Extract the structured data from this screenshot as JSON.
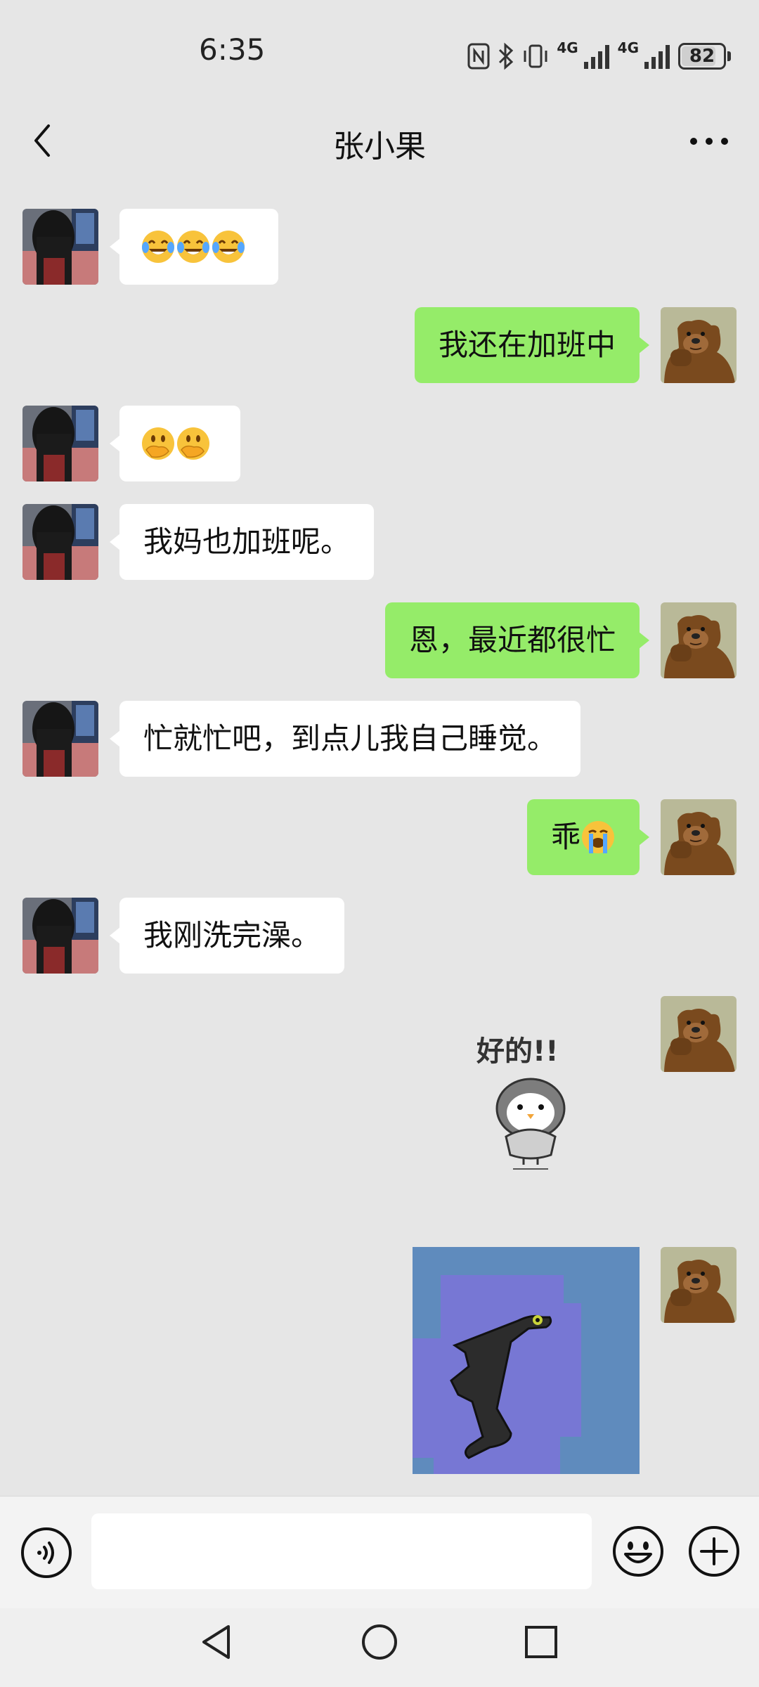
{
  "status_bar": {
    "time": "6:35",
    "network_1": "4G",
    "network_2": "4G",
    "battery": "82"
  },
  "header": {
    "title": "张小果",
    "back_icon": "chevron-left-icon",
    "more_icon": "more-horizontal-icon"
  },
  "messages": [
    {
      "side": "in",
      "type": "emoji",
      "emoji": "face-with-tears-of-joy x3"
    },
    {
      "side": "out",
      "type": "text",
      "text": "我还在加班中"
    },
    {
      "side": "in",
      "type": "emoji",
      "emoji": "face-with-hand-over-mouth x2"
    },
    {
      "side": "in",
      "type": "text",
      "text": "我妈也加班呢。"
    },
    {
      "side": "out",
      "type": "text",
      "text": "恩，最近都很忙"
    },
    {
      "side": "in",
      "type": "text",
      "text": "忙就忙吧，到点儿我自己睡觉。"
    },
    {
      "side": "out",
      "type": "text+emoji",
      "text": "乖",
      "emoji": "loudly-crying-face"
    },
    {
      "side": "in",
      "type": "text",
      "text": "我刚洗完澡。"
    },
    {
      "side": "out",
      "type": "sticker",
      "sticker": "penguin-sticker",
      "caption": "好的!!"
    },
    {
      "side": "out",
      "type": "sticker",
      "sticker": "dragon-dance-sticker"
    }
  ],
  "input_bar": {
    "voice_icon": "voice-icon",
    "emoji_icon": "smile-icon",
    "plus_icon": "plus-icon",
    "placeholder": ""
  },
  "nav_bar": {
    "back_icon": "triangle-back-icon",
    "home_icon": "circle-home-icon",
    "recent_icon": "square-recent-icon"
  },
  "colors": {
    "background": "#e6e6e6",
    "incoming_bubble": "#ffffff",
    "outgoing_bubble": "#95ec69"
  }
}
